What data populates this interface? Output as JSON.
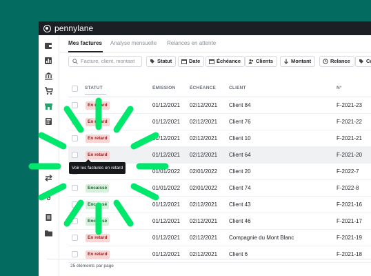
{
  "app": {
    "brand": "pennylane"
  },
  "sidebar": {
    "icons": [
      "wallet-icon",
      "chart-icon",
      "bank-icon",
      "cart-icon",
      "store-icon",
      "calculator-icon",
      "transfer-icon",
      "paperclip-icon",
      "document-icon",
      "folder-icon"
    ]
  },
  "tabs": [
    {
      "label": "Mes factures",
      "active": true
    },
    {
      "label": "Analyse mensuelle",
      "active": false
    },
    {
      "label": "Relances en attente",
      "active": false
    }
  ],
  "search": {
    "placeholder": "Facture, client, montant"
  },
  "filters": [
    "Statut",
    "Date",
    "Échéance",
    "Clients",
    "Montant",
    "Relance",
    "Ca"
  ],
  "table": {
    "headers": [
      "STATUT",
      "ÉMISSION",
      "ÉCHÉANCE",
      "CLIENT",
      "N°"
    ],
    "rows": [
      {
        "status": "En retard",
        "emission": "01/12/2021",
        "echeance": "02/12/2021",
        "client": "Client 84",
        "number": "F-2021-23"
      },
      {
        "status": "En retard",
        "emission": "01/12/2021",
        "echeance": "02/12/2021",
        "client": "Client 76",
        "number": "F-2021-22"
      },
      {
        "status": "En retard",
        "emission": "01/12/2021",
        "echeance": "02/12/2021",
        "client": "Client 10",
        "number": "F-2021-21"
      },
      {
        "status": "En retard",
        "emission": "01/12/2021",
        "echeance": "02/12/2021",
        "client": "Client 64",
        "number": "F-2021-20"
      },
      {
        "status": "",
        "emission": "01/01/2022",
        "echeance": "02/01/2022",
        "client": "Client 20",
        "number": "F-2022-7"
      },
      {
        "status": "Encaissé",
        "emission": "01/01/2022",
        "echeance": "02/01/2022",
        "client": "Client 74",
        "number": "F-2022-8"
      },
      {
        "status": "Encaissé",
        "emission": "01/12/2021",
        "echeance": "02/12/2021",
        "client": "Client 43",
        "number": "F-2021-16"
      },
      {
        "status": "Encaissé",
        "emission": "01/12/2021",
        "echeance": "02/12/2021",
        "client": "Client 46",
        "number": "F-2021-17"
      },
      {
        "status": "En retard",
        "emission": "01/12/2021",
        "echeance": "02/12/2021",
        "client": "Compagnie du Mont Blanc",
        "number": "F-2021-19"
      },
      {
        "status": "En retard",
        "emission": "01/12/2021",
        "echeance": "02/12/2021",
        "client": "Client 6",
        "number": "F-2021-18"
      }
    ]
  },
  "tooltip": "Voir les factures en retard",
  "footer": {
    "count_text": "25 éléments par page"
  },
  "colors": {
    "background": "#036b5f",
    "burst": "#00e86b",
    "late": "#f8d6d6",
    "paid": "#d6f0dc"
  }
}
